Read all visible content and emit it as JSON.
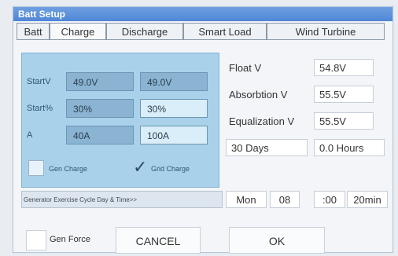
{
  "window": {
    "title": "Batt Setup"
  },
  "tabs": [
    {
      "label": "Batt"
    },
    {
      "label": "Charge"
    },
    {
      "label": "Discharge"
    },
    {
      "label": "Smart Load"
    },
    {
      "label": "Wind Turbine"
    }
  ],
  "left_panel": {
    "rows": [
      {
        "label": "StartV",
        "value1": "49.0V",
        "value2": "49.0V"
      },
      {
        "label": "Start%",
        "value1": "30%",
        "value2": "30%"
      },
      {
        "label": "A",
        "value1": "40A",
        "value2": "100A"
      }
    ],
    "gen_charge_label": "Gen Charge",
    "grid_charge_label": "Grid Charge",
    "grid_charge_checked": true,
    "gen_charge_checked": false
  },
  "right_panel": {
    "float_label": "Float V",
    "float_value": "54.8V",
    "absorption_label": "Absorbtion V",
    "absorption_value": "55.5V",
    "equalization_label": "Equalization V",
    "equalization_value": "55.5V",
    "days_value": "30 Days",
    "hours_value": "0.0 Hours"
  },
  "generator_row": {
    "label": "Generator Exercise Cycle Day & Time>>",
    "day": "Mon",
    "hour": "08",
    "minute": ":00",
    "duration": "20min"
  },
  "footer": {
    "gen_force_label": "Gen Force",
    "cancel_label": "CANCEL",
    "ok_label": "OK"
  }
}
